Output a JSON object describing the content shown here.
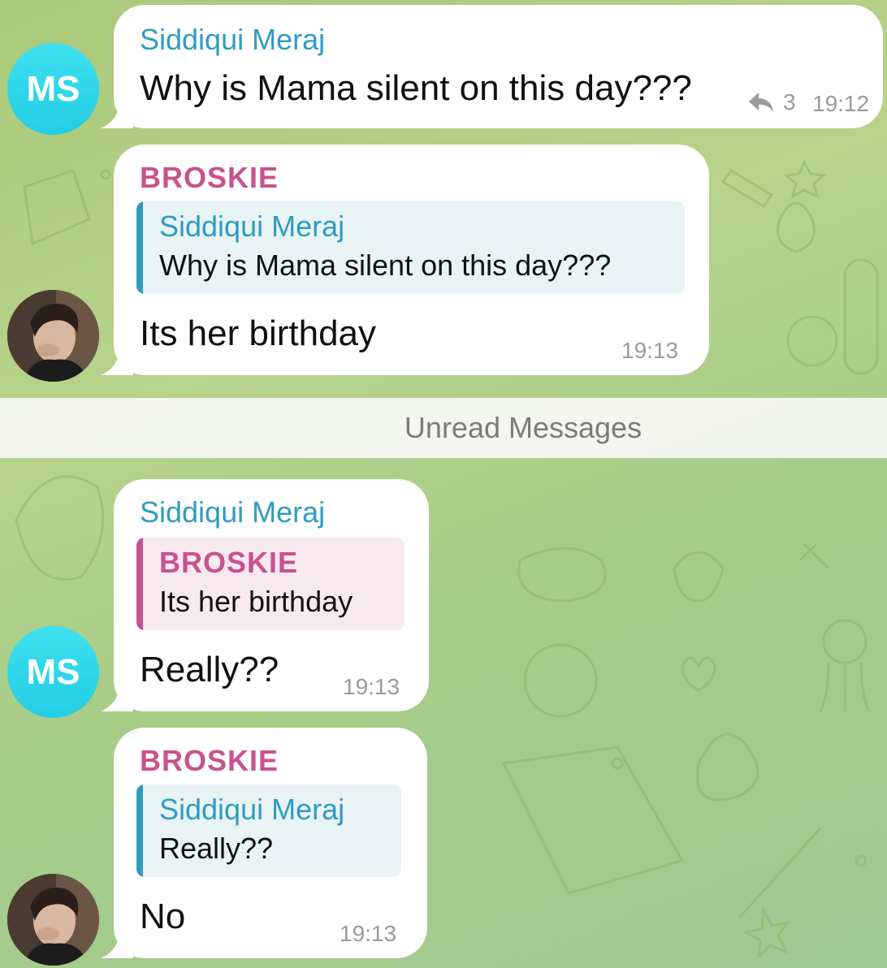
{
  "divider": {
    "label": "Unread Messages"
  },
  "messages": [
    {
      "avatar_initials": "MS",
      "sender": "Siddiqui Meraj",
      "text": "Why is Mama silent on this day???",
      "replies_count": "3",
      "time": "19:12"
    },
    {
      "avatar": "photo",
      "sender": "BROSKIE",
      "reply_to": {
        "name": "Siddiqui Meraj",
        "text": "Why is Mama silent on this day???"
      },
      "text": "Its her birthday",
      "time": "19:13"
    },
    {
      "avatar_initials": "MS",
      "sender": "Siddiqui Meraj",
      "reply_to": {
        "name": "BROSKIE",
        "text": "Its her birthday"
      },
      "text": "Really??",
      "time": "19:13"
    },
    {
      "avatar": "photo",
      "sender": "BROSKIE",
      "reply_to": {
        "name": "Siddiqui Meraj",
        "text": "Really??"
      },
      "text": "No",
      "time": "19:13"
    }
  ],
  "colors": {
    "accent_blue": "#2f9cbf",
    "accent_pink": "#c8528f",
    "avatar_cyan": "#22cde3"
  }
}
